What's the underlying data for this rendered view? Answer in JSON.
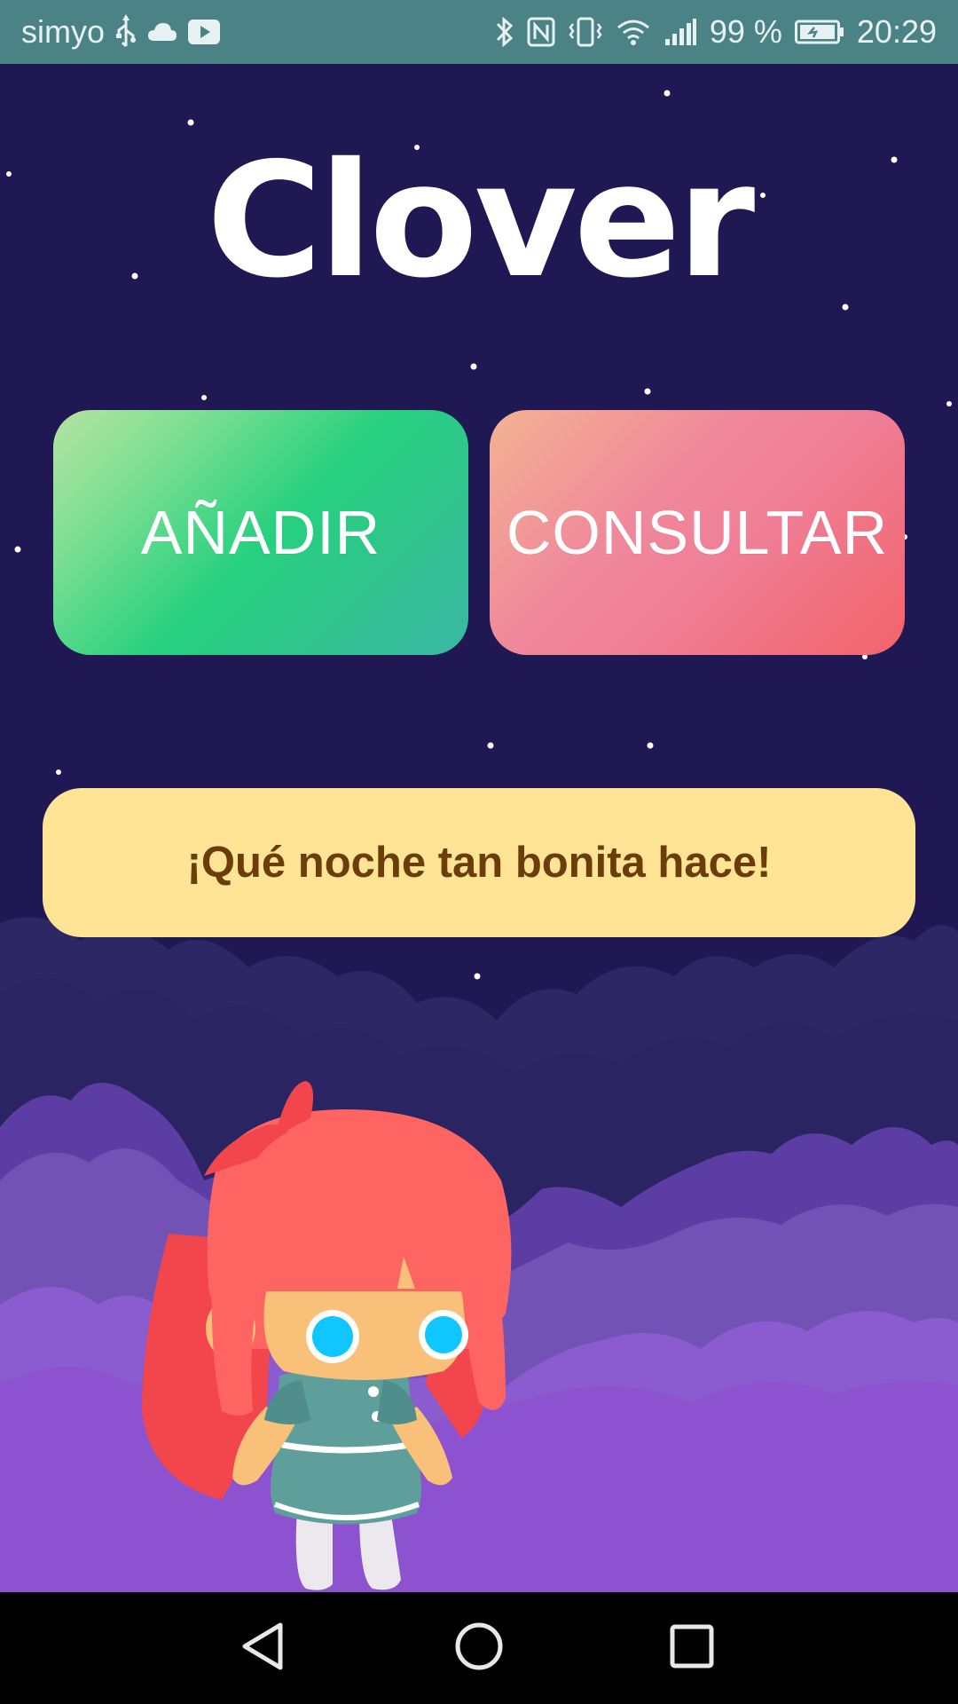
{
  "status_bar": {
    "carrier": "simyo",
    "icons_left": [
      "usb-icon",
      "cloud-icon",
      "youtube-icon"
    ],
    "icons_right": [
      "bluetooth-icon",
      "nfc-icon",
      "vibrate-icon",
      "wifi-icon",
      "signal-icon"
    ],
    "battery": "99 %",
    "time": "20:29"
  },
  "app": {
    "title": "Clover",
    "buttons": {
      "add_label": "AÑADIR",
      "consult_label": "CONSULTAR"
    },
    "message": "¡Qué noche tan bonita hace!"
  },
  "colors": {
    "background": "#1f1852",
    "status_bar": "#4a8286",
    "message_bg": "#fee494",
    "message_text": "#6b3d0a"
  },
  "nav_bar": {
    "icons": [
      "back-icon",
      "home-icon",
      "recents-icon"
    ]
  }
}
